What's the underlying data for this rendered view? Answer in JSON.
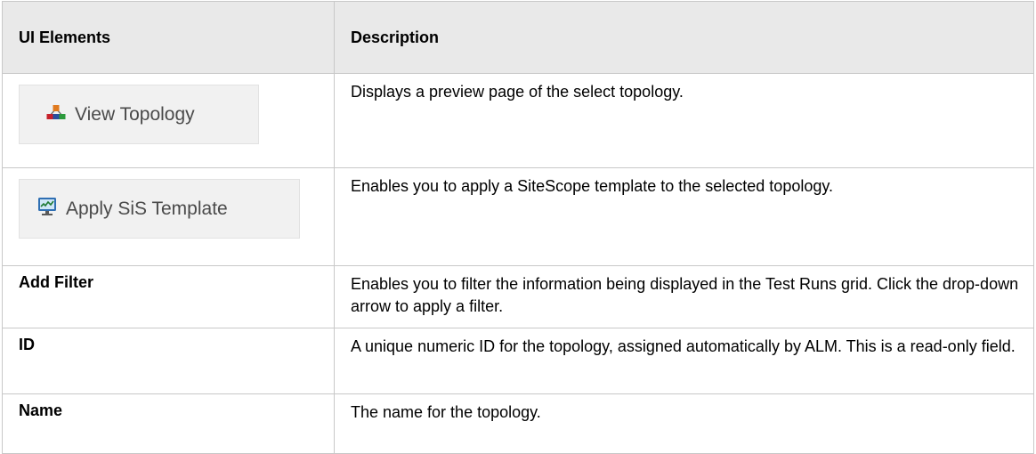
{
  "table": {
    "headers": [
      "UI Elements",
      "Description"
    ],
    "rows": [
      {
        "element": "View Topology",
        "element_icon": "topology-icon",
        "description": "Displays a preview page of the select topology."
      },
      {
        "element": "Apply SiS Template",
        "element_icon": "monitor-chart-icon",
        "description": "Enables you to apply a SiteScope template to the selected topology."
      },
      {
        "element": "Add Filter",
        "description": "Enables you to filter the information being displayed in the Test Runs grid. Click the drop-down arrow to apply a filter."
      },
      {
        "element": "ID",
        "description": "A unique numeric ID for the topology, assigned automatically by ALM. This is a read-only field."
      },
      {
        "element": "Name",
        "description": "The name for the topology."
      }
    ]
  }
}
